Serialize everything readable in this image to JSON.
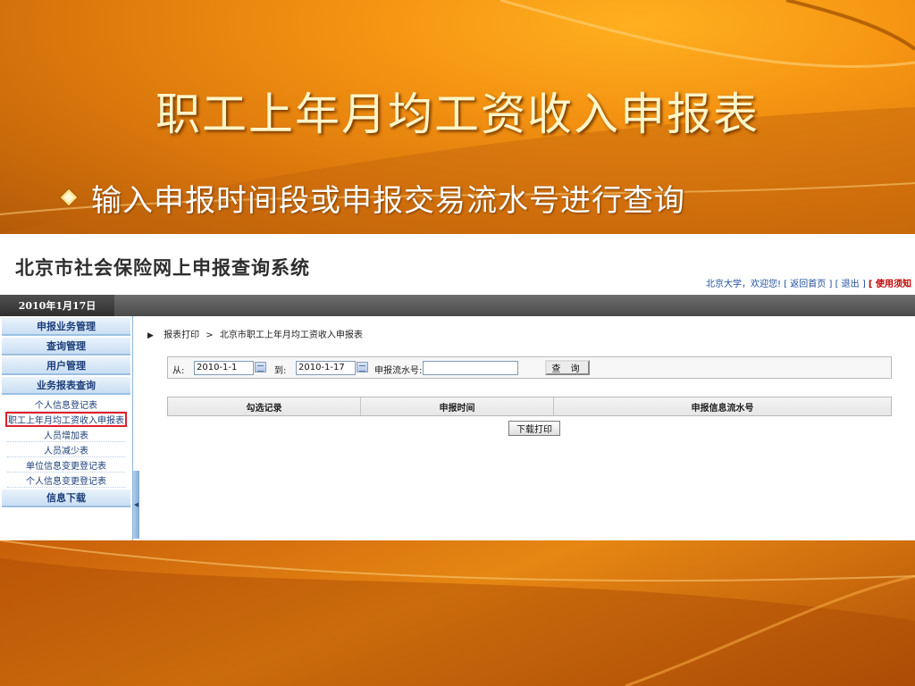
{
  "slide": {
    "title": "职工上年月均工资收入申报表",
    "bullet": "输入申报时间段或申报交易流水号进行查询",
    "colors": {
      "accent": "#f29a18",
      "title": "#fff5c8"
    }
  },
  "app": {
    "logo": "北京市社会保险网上申报查询系统",
    "header": {
      "user": "北京大学，欢迎您!",
      "links": [
        "[ 返回首页 ]",
        "[ 退出 ]",
        "[ 使用须知 ]"
      ]
    },
    "date": "2010年1月17日",
    "sidebar": {
      "sections": [
        {
          "label": "申报业务管理"
        },
        {
          "label": "查询管理"
        },
        {
          "label": "用户管理"
        },
        {
          "label": "业务报表查询"
        }
      ],
      "items": [
        {
          "label": "个人信息登记表"
        },
        {
          "label": "职工上年月均工资收入申报表",
          "active": true
        },
        {
          "label": "人员增加表"
        },
        {
          "label": "人员减少表"
        },
        {
          "label": "单位信息变更登记表"
        },
        {
          "label": "个人信息变更登记表"
        }
      ],
      "last_section": "信息下载"
    },
    "breadcrumb": {
      "root": "报表打印",
      "separator": ">",
      "current": "北京市职工上年月均工资收入申报表"
    },
    "filters": {
      "from_label": "从:",
      "from_value": "2010-1-1",
      "to_label": "到:",
      "to_value": "2010-1-17",
      "serial_label": "申报流水号:",
      "serial_value": "",
      "query_button": "查 询"
    },
    "table": {
      "columns": [
        "勾选记录",
        "申报时间",
        "申报信息流水号"
      ],
      "rows": []
    },
    "download_button": "下载打印"
  }
}
